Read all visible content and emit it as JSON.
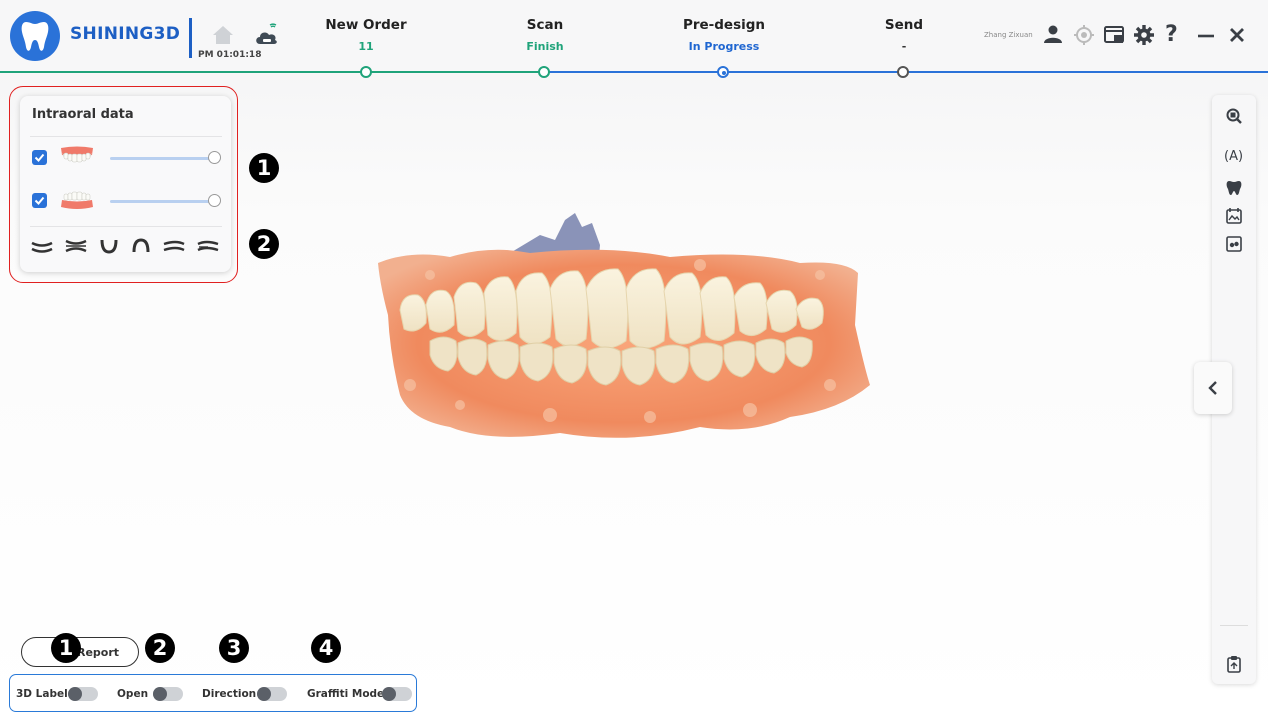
{
  "header": {
    "brand": "SHINING3D",
    "clock": "PM 01:01:18",
    "user_name": "Zhang Zixuan",
    "steps": [
      {
        "title": "New Order",
        "status": "11",
        "status_color": "#1fa37a"
      },
      {
        "title": "Scan",
        "status": "Finish",
        "status_color": "#1fa37a"
      },
      {
        "title": "Pre-design",
        "status": "In Progress",
        "status_color": "#1f66d1"
      },
      {
        "title": "Send",
        "status": "-",
        "status_color": "#333333"
      }
    ]
  },
  "left_panel": {
    "title": "Intraoral data",
    "rows": [
      {
        "name": "upper-jaw",
        "checked": true,
        "opacity_percent": 100
      },
      {
        "name": "lower-jaw",
        "checked": true,
        "opacity_percent": 100
      }
    ],
    "view_icons": [
      "view-top-icon",
      "view-side-icon",
      "view-lower-arch-icon",
      "view-upper-arch-icon",
      "view-left-icon",
      "view-right-icon"
    ],
    "badges": [
      "1",
      "2"
    ]
  },
  "bottom": {
    "report_label": "Report",
    "toggles": [
      {
        "label": "3D Label",
        "on": false
      },
      {
        "label": "Open",
        "on": false
      },
      {
        "label": "Direction",
        "on": false
      },
      {
        "label": "Graffiti Mode",
        "on": false
      }
    ],
    "badges": [
      "1",
      "2",
      "3",
      "4"
    ]
  },
  "colors": {
    "brand": "#1d5fc4",
    "accent_blue": "#2a72d8",
    "done_green": "#1fa37a",
    "annotation_red": "#e02020"
  }
}
